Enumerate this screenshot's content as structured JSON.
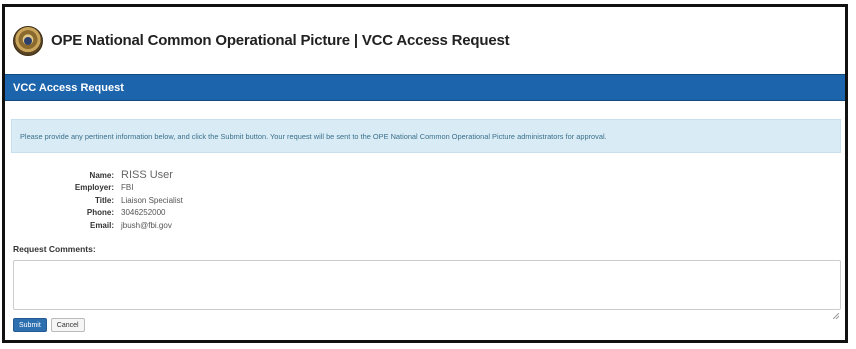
{
  "header": {
    "title": "OPE National Common Operational Picture | VCC Access Request",
    "logo_icon": "seal-icon"
  },
  "panel": {
    "title": "VCC Access Request",
    "accent_color": "#1c64ab"
  },
  "info_message": "Please provide any pertinent information below, and click the Submit button. Your request will be sent to the OPE National Common Operational Picture administrators for approval.",
  "user_details": [
    {
      "label": "Name:",
      "value": "RISS User"
    },
    {
      "label": "Employer:",
      "value": "FBI"
    },
    {
      "label": "Title:",
      "value": "Liaison Specialist"
    },
    {
      "label": "Phone:",
      "value": "3046252000"
    },
    {
      "label": "Email:",
      "value": "jbush@fbi.gov"
    }
  ],
  "comments": {
    "label": "Request Comments:",
    "value": ""
  },
  "buttons": {
    "submit": "Submit",
    "cancel": "Cancel"
  }
}
